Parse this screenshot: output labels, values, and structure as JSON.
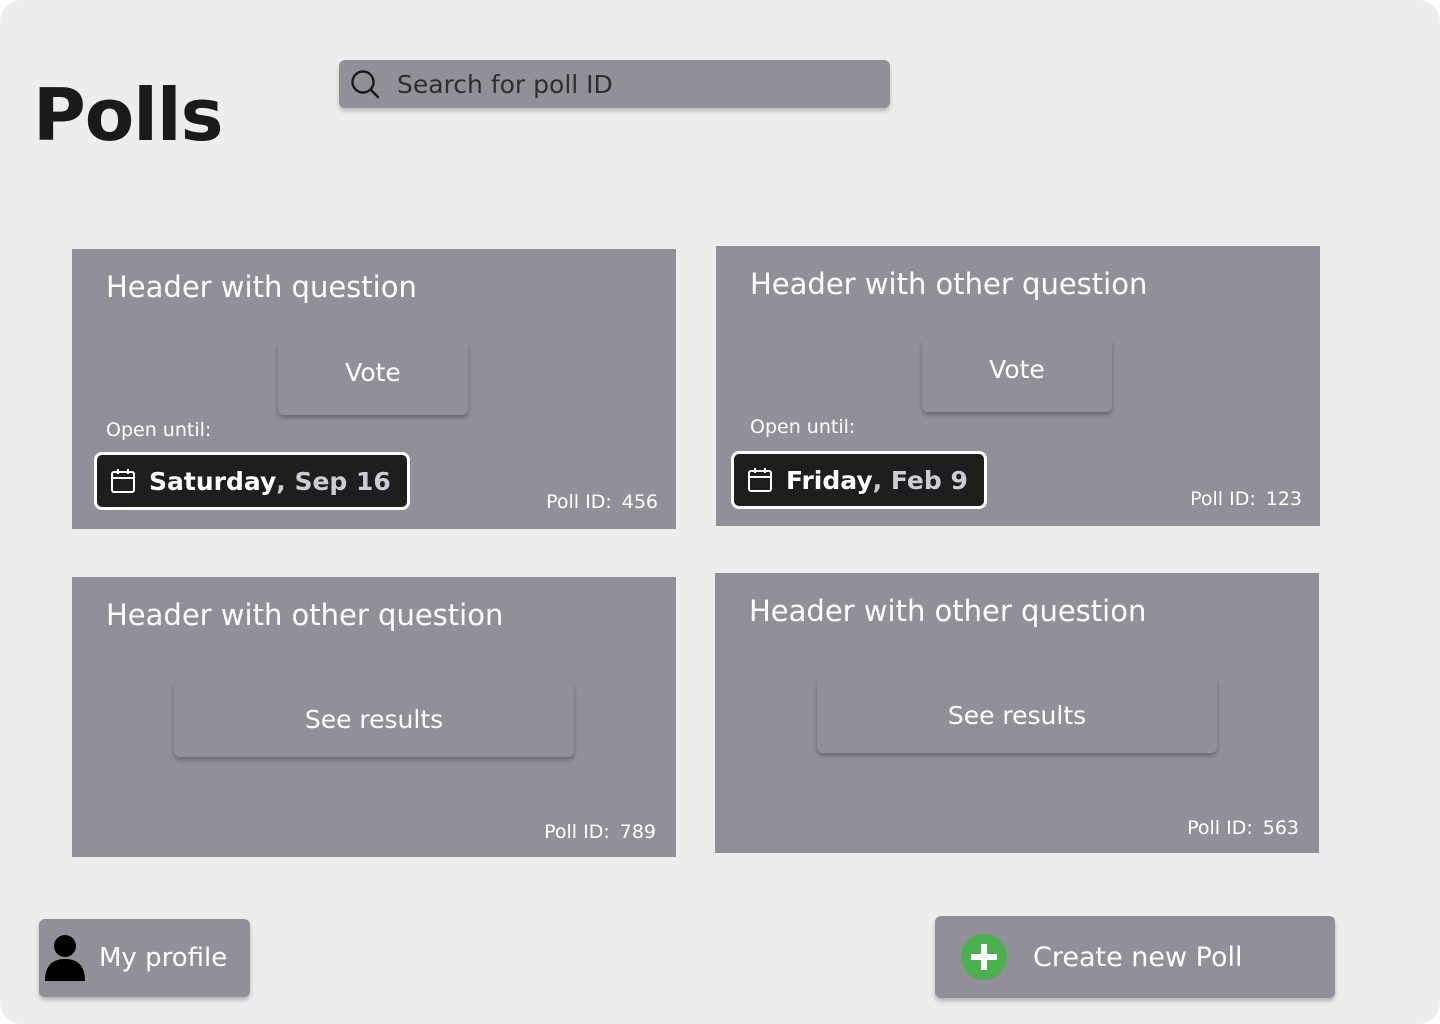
{
  "page": {
    "title": "Polls"
  },
  "search": {
    "placeholder": "Search for poll ID",
    "value": ""
  },
  "polls": [
    {
      "header": "Header with question",
      "action_label": "Vote",
      "open_label": "Open until:",
      "date_day": "Saturday",
      "date_rest": ", Sep 16",
      "id_label": "Poll ID:",
      "id_value": "456"
    },
    {
      "header": "Header with other question",
      "action_label": "Vote",
      "open_label": "Open until:",
      "date_day": "Friday",
      "date_rest": ", Feb 9",
      "id_label": "Poll ID:",
      "id_value": "123"
    },
    {
      "header": "Header with other question",
      "action_label": "See results",
      "id_label": "Poll ID:",
      "id_value": "789"
    },
    {
      "header": "Header with other question",
      "action_label": "See results",
      "id_label": "Poll ID:",
      "id_value": "563"
    }
  ],
  "footer": {
    "profile_label": "My profile",
    "profile_icon": "person-icon",
    "create_label": "Create new Poll",
    "create_icon": "plus-circle-icon"
  },
  "colors": {
    "background": "#ededed",
    "card": "#938f99",
    "text_dark": "#1a1a1a",
    "chip": "#1e1e1e",
    "accent_green": "#4caf50"
  }
}
